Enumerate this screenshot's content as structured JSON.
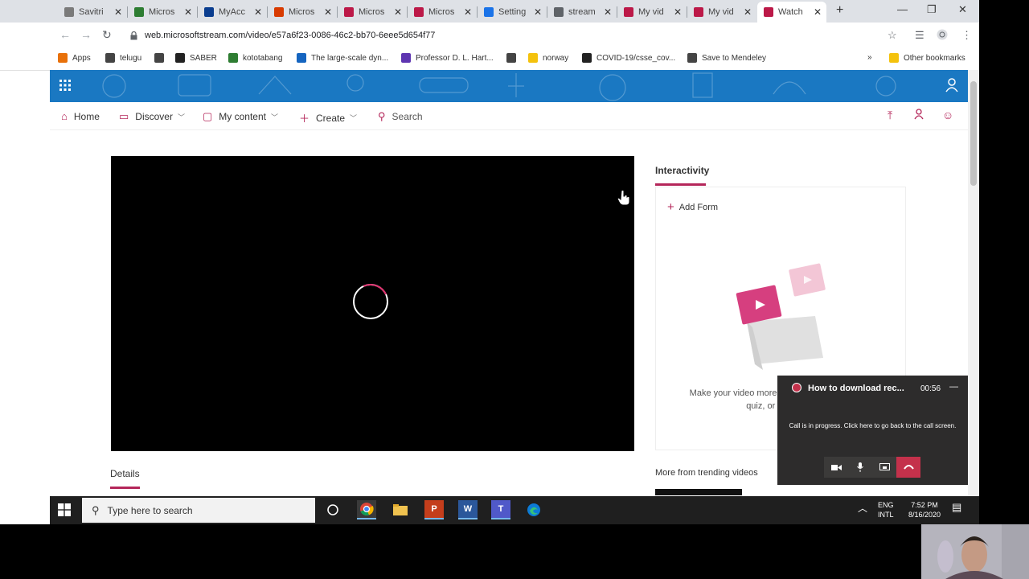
{
  "browser": {
    "tabs": [
      {
        "title": "Savitri",
        "color": "#7a7a7a"
      },
      {
        "title": "Micros",
        "color": "#2d7d32"
      },
      {
        "title": "MyAcc",
        "color": "#0a3d8f"
      },
      {
        "title": "Micros",
        "color": "#d83b01"
      },
      {
        "title": "Micros",
        "color": "#bc1948"
      },
      {
        "title": "Micros",
        "color": "#bc1948"
      },
      {
        "title": "Setting",
        "color": "#1a73e8"
      },
      {
        "title": "stream",
        "color": "#5f6368"
      },
      {
        "title": "My vid",
        "color": "#bc1948"
      },
      {
        "title": "My vid",
        "color": "#bc1948"
      },
      {
        "title": "Watch",
        "color": "#bc1948"
      }
    ],
    "url": "web.microsoftstream.com/video/e57a6f23-0086-46c2-bb70-6eee5d654f77",
    "bookmarks": [
      {
        "label": "Apps",
        "color": "#e8710a"
      },
      {
        "label": "telugu",
        "color": "#444444"
      },
      {
        "label": "",
        "color": "#444444"
      },
      {
        "label": "SABER",
        "color": "#222222"
      },
      {
        "label": "kototabang",
        "color": "#2e7d32"
      },
      {
        "label": "The large-scale dyn...",
        "color": "#1565c0"
      },
      {
        "label": "Professor D. L. Hart...",
        "color": "#5e35b1"
      },
      {
        "label": "",
        "color": "#444444"
      },
      {
        "label": "norway",
        "color": "#f4c20d"
      },
      {
        "label": "COVID-19/csse_cov...",
        "color": "#222222"
      },
      {
        "label": "Save to Mendeley",
        "color": "#444444"
      }
    ],
    "other_bookmarks": "Other bookmarks"
  },
  "stream": {
    "nav": {
      "home": "Home",
      "discover": "Discover",
      "my_content": "My content",
      "create": "Create",
      "search": "Search"
    },
    "details_tab": "Details",
    "interactivity": {
      "label": "Interactivity",
      "add_form": "Add Form",
      "description": "Make your video more engaging with a survey, quiz, or poll using"
    },
    "trending": "More from trending videos",
    "accent": "#b4265a",
    "banner_color": "#1a78c2"
  },
  "call": {
    "title": "How to download rec...",
    "time": "00:56",
    "message": "Call is in progress. Click here to go back to the call screen."
  },
  "taskbar": {
    "search_placeholder": "Type here to search",
    "lang1": "ENG",
    "lang2": "INTL",
    "time": "7:52 PM",
    "date": "8/16/2020"
  }
}
